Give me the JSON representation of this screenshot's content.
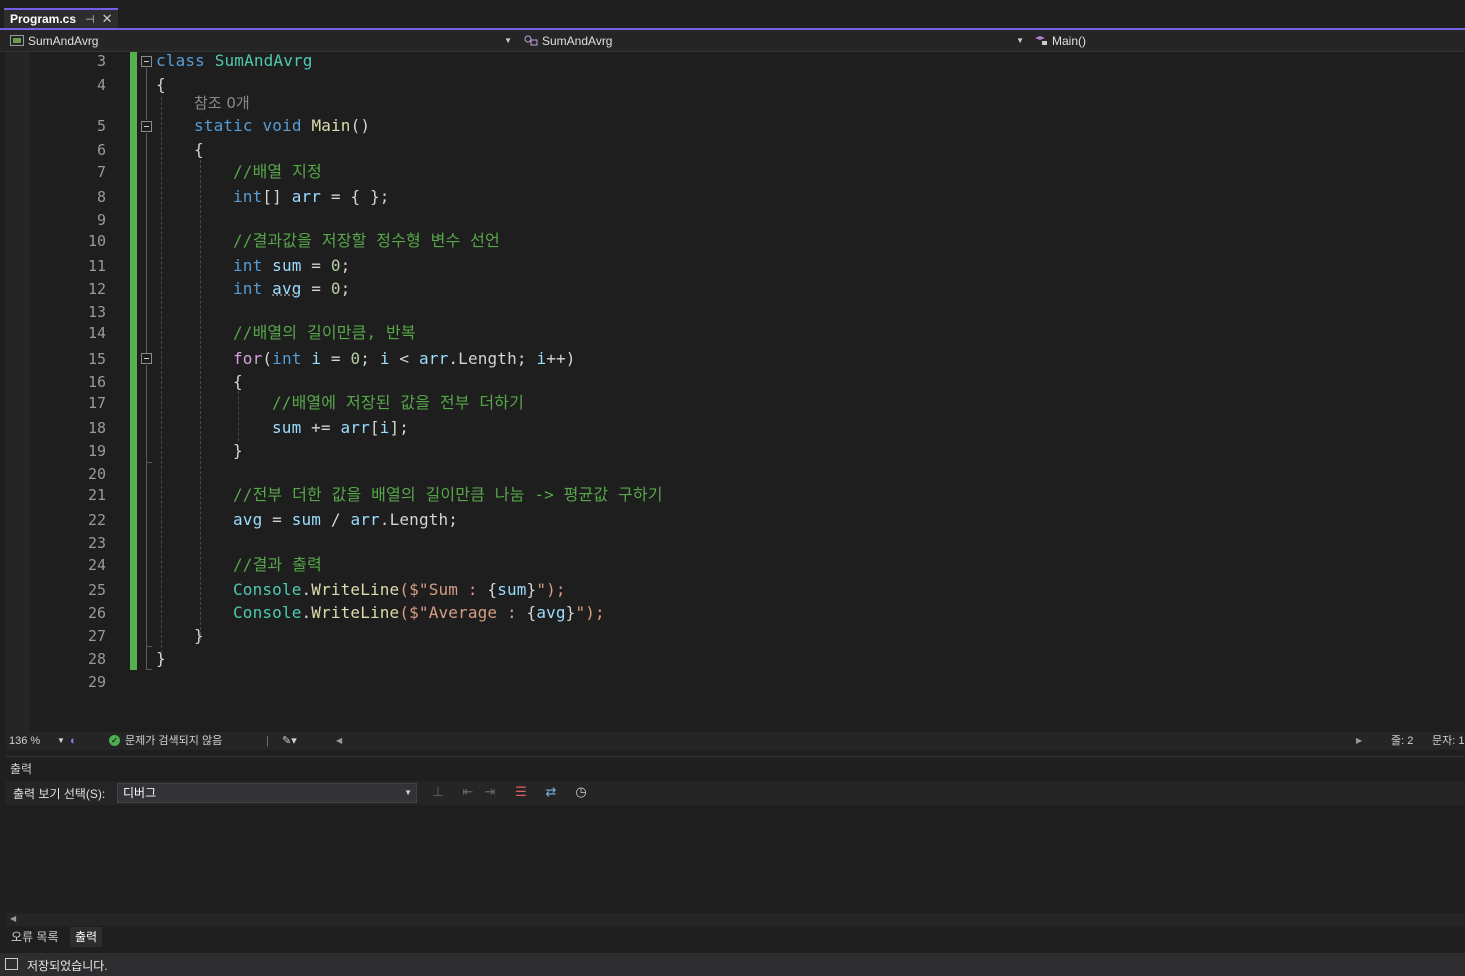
{
  "tab": {
    "title": "Program.cs",
    "pin_glyph": "⊣",
    "close_glyph": "✕"
  },
  "nav": {
    "project": "SumAndAvrg",
    "class": "SumAndAvrg",
    "member": "Main()"
  },
  "editor": {
    "codelens": "참조 0개",
    "line_numbers": [
      "3",
      "4",
      "5",
      "6",
      "7",
      "8",
      "9",
      "10",
      "11",
      "12",
      "13",
      "14",
      "15",
      "16",
      "17",
      "18",
      "19",
      "20",
      "21",
      "22",
      "23",
      "24",
      "25",
      "26",
      "27",
      "28",
      "29"
    ],
    "tokens": {
      "class_kw": "class",
      "class_name": "SumAndAvrg",
      "open_brace": "{",
      "close_brace": "}",
      "static_kw": "static",
      "void_kw": "void",
      "main_name": "Main",
      "parens": "()",
      "comment_array": "//배열 지정",
      "int_kw": "int",
      "brackets": "[]",
      "arr": "arr",
      "array_init": " = { };",
      "comment_result_var": "//결과값을 저장할 정수형 변수 선언",
      "sum": "sum",
      "avg": "avg",
      "assign": " = ",
      "zero": "0",
      "semicolon": ";",
      "comment_loop": "//배열의 길이만큼, 반복",
      "for_kw": "for",
      "lparen": "(",
      "i": "i",
      "lt": " < ",
      "length": "Length",
      "dot": ".",
      "incr": "++)",
      "semi_space": "; ",
      "comment_add": "//배열에 저장된 값을 전부 더하기",
      "plus_assign": " += ",
      "lbracket": "[",
      "rbracket": "];",
      "comment_avg": "//전부 더한 값을 배열의 길이만큼 나눔 -> 평균값 구하기",
      "div": " / ",
      "comment_output": "//결과 출력",
      "console": "Console",
      "writeline": "WriteLine",
      "interp_open": "($\"",
      "sum_label": "Sum : ",
      "avg_label": "Average : ",
      "lcurly": "{",
      "rcurly": "}",
      "interp_close": "\");"
    }
  },
  "editor_status": {
    "zoom": "136 %",
    "issues": "문제가 검색되지 않음",
    "line": "줄: 2",
    "col": "문자: 1"
  },
  "output": {
    "title": "출력",
    "source_label": "출력 보기 선택(S):",
    "source_value": "디버그"
  },
  "panel_tabs": [
    "오류 목록",
    "출력"
  ],
  "statusbar": {
    "message": "저장되었습니다."
  },
  "colors": {
    "accent": "#7160e8",
    "change_bar": "#56b14f",
    "keyword": "#569cd6",
    "type": "#4ec9b0",
    "comment": "#57a64a",
    "string": "#d69d85"
  }
}
